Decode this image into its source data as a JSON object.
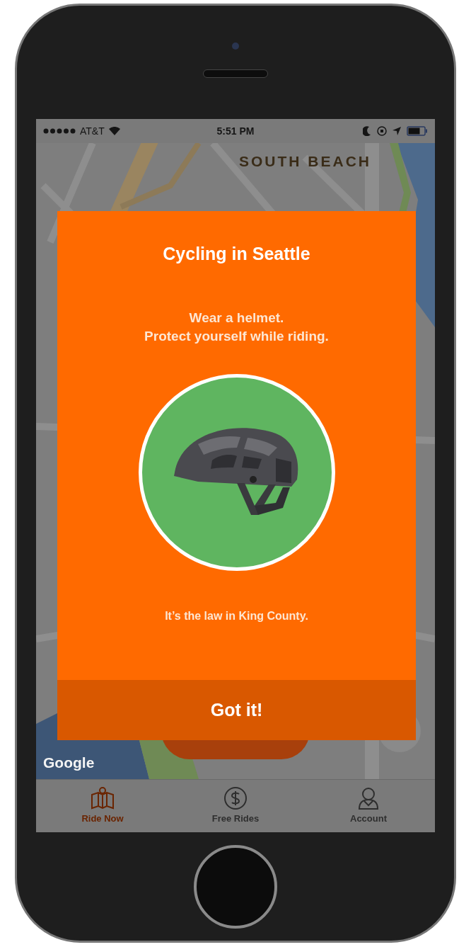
{
  "status_bar": {
    "carrier": "AT&T",
    "time": "5:51 PM"
  },
  "map": {
    "area_label": "SOUTH BEACH",
    "attribution": "Google"
  },
  "dialog": {
    "title": "Cycling in Seattle",
    "message_lines": [
      "Wear a helmet.",
      "Protect yourself while riding."
    ],
    "footnote": "It’s the law in King County.",
    "button": "Got it!"
  },
  "tab_bar": [
    {
      "label": "Ride Now",
      "selected": true
    },
    {
      "label": "Free Rides",
      "selected": false
    },
    {
      "label": "Account",
      "selected": false
    }
  ]
}
